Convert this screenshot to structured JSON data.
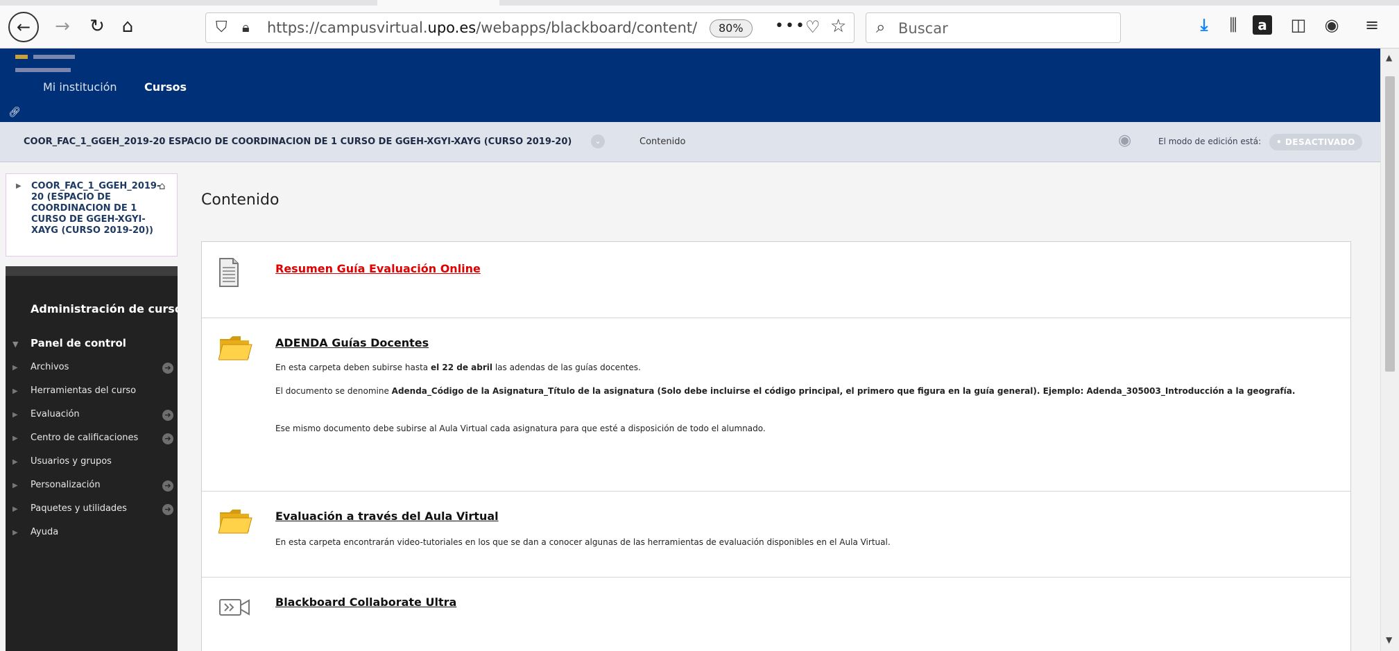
{
  "browser": {
    "url_prefix": "https://campusvirtual.",
    "url_domain": "upo.es",
    "url_path": "/webapps/blackboard/content/listContent",
    "zoom": "80%",
    "search_placeholder": "Buscar",
    "more_label": "•••"
  },
  "top_nav": {
    "items": [
      {
        "label": "Mi institución"
      },
      {
        "label": "Cursos"
      }
    ]
  },
  "breadcrumb": {
    "course": "COOR_FAC_1_GGEH_2019-20 ESPACIO DE COORDINACION DE 1 CURSO DE GGEH-XGYI-XAYG (CURSO 2019-20)",
    "current": "Contenido",
    "edit_mode_label": "El modo de edición está:",
    "edit_mode_value": "• DESACTIVADO"
  },
  "course_box": {
    "title": "COOR_FAC_1_GGEH_2019-20 (ESPACIO DE COORDINACION DE 1 CURSO DE GGEH-XGYI-XAYG (CURSO 2019-20))"
  },
  "sidebar": {
    "admin_title": "Administración de cursos",
    "panel_title": "Panel de control",
    "items": [
      {
        "label": "Archivos"
      },
      {
        "label": "Herramientas del curso"
      },
      {
        "label": "Evaluación"
      },
      {
        "label": "Centro de calificaciones"
      },
      {
        "label": "Usuarios y grupos"
      },
      {
        "label": "Personalización"
      },
      {
        "label": "Paquetes y utilidades"
      },
      {
        "label": "Ayuda"
      }
    ]
  },
  "main": {
    "title": "Contenido",
    "items": [
      {
        "title": "Resumen Guía Evaluación Online",
        "icon": "document-icon"
      },
      {
        "title": "ADENDA Guías Docentes",
        "icon": "folder-icon",
        "p1_a": "En esta carpeta deben subirse hasta ",
        "p1_b": "el 22 de abril",
        "p1_c": " las adendas de las guías docentes.",
        "p2_a": "El documento se denomine ",
        "p2_b": "Adenda_Código de la Asignatura_Título de la asignatura (Solo debe incluirse el código principal, el primero que figura en la guía general). Ejemplo: Adenda_305003_Introducción a la geografía.",
        "p3": "Ese mismo documento debe subirse al Aula Virtual cada asignatura para que esté a disposición de todo el alumnado."
      },
      {
        "title": "Evaluación a través del Aula Virtual",
        "icon": "folder-icon",
        "p1": "En esta carpeta encontrarán video-tutoriales en los que se dan a conocer algunas de las herramientas de evaluación disponibles en el Aula Virtual."
      },
      {
        "title": "Blackboard Collaborate Ultra",
        "icon": "collaborate-icon"
      }
    ]
  },
  "colors": {
    "header_bg": "#003078",
    "sidebar_bg": "#222222",
    "link_red": "#e00000"
  }
}
